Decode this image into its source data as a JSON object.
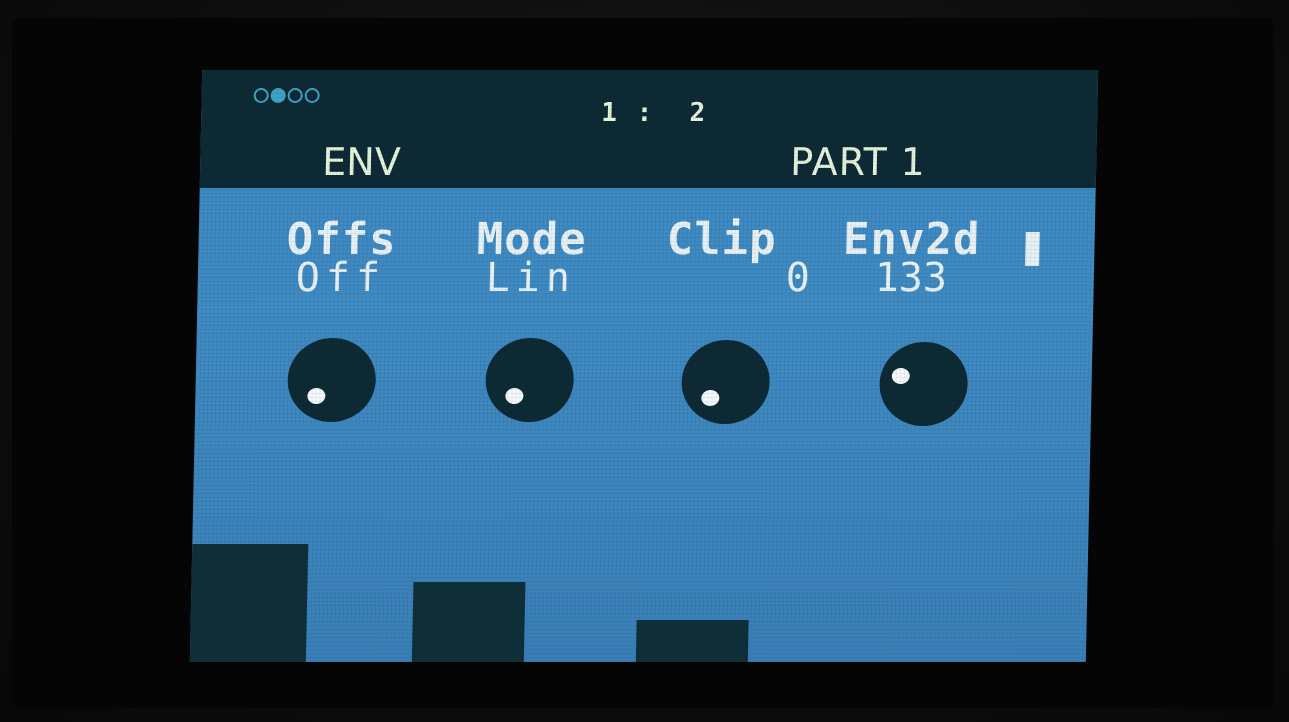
{
  "header": {
    "page_indicator": {
      "count": 4,
      "active_index": 1
    },
    "position": "1 :  2",
    "page_title": "ENV",
    "part_label": "PART 1"
  },
  "params": [
    {
      "name": "Offs",
      "value": "Off",
      "knob_indicator": "lower-left"
    },
    {
      "name": "Mode",
      "value": "Lin",
      "knob_indicator": "lower-left"
    },
    {
      "name": "Clip",
      "value": "0",
      "knob_indicator": "lower-left"
    },
    {
      "name": "Env2d",
      "value": "133",
      "knob_indicator": "upper-left"
    }
  ],
  "colors": {
    "screen_bg": "#3b87c0",
    "header_bg": "#0d2a35",
    "text": "#e6f3dc",
    "indicator_accent": "#3fa3c6",
    "knob": "#0d2a35",
    "knob_dot": "#f4f9fb"
  }
}
